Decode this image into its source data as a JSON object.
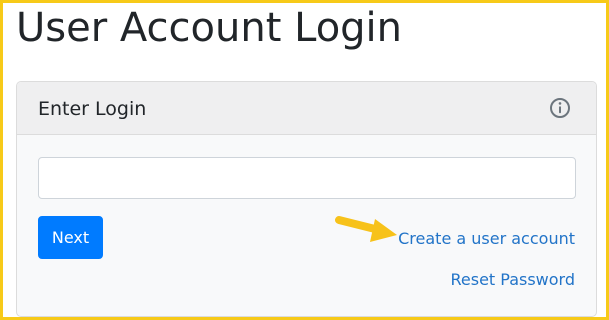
{
  "page": {
    "title": "User Account Login",
    "frame_color": "#f7ca18"
  },
  "card": {
    "header_title": "Enter Login",
    "header_icon": "info-circle-icon"
  },
  "login_input": {
    "value": "",
    "placeholder": ""
  },
  "actions": {
    "next_label": "Next",
    "next_color": "#007bff",
    "create_account_label": "Create a user account",
    "reset_password_label": "Reset Password",
    "link_color": "#2274c8"
  },
  "annotation": {
    "icon": "pointing-arrow-icon",
    "color": "#f7c21a"
  }
}
